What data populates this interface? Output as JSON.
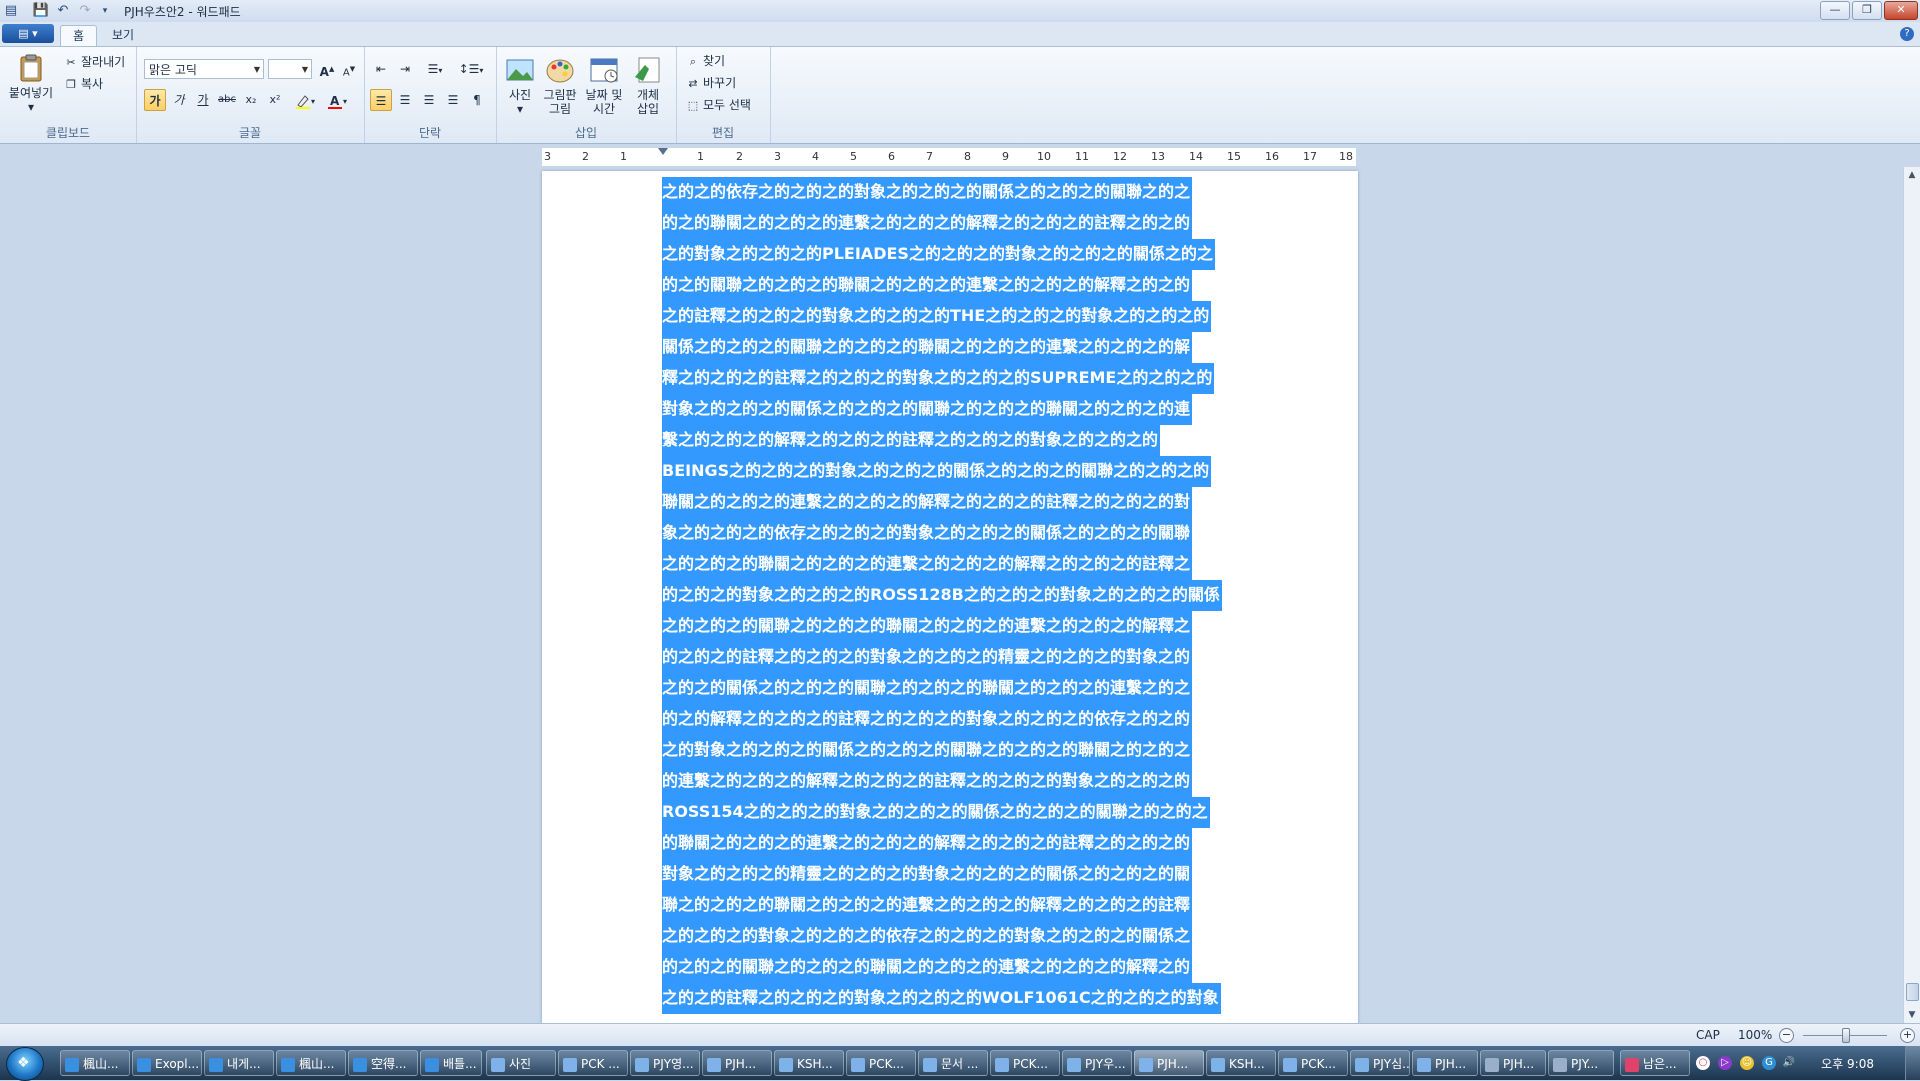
{
  "window": {
    "title": "PJH우츠안2 - 워드패드",
    "buttons": {
      "minimize": "—",
      "maximize": "❐",
      "close": "✕"
    }
  },
  "tabs": [
    {
      "label": "홈",
      "active": true
    },
    {
      "label": "보기",
      "active": false
    }
  ],
  "ribbon": {
    "clipboard": {
      "group_label": "클립보드",
      "paste": "붙여넣기",
      "cut": "잘라내기",
      "copy": "복사"
    },
    "font": {
      "group_label": "글꼴",
      "font_name": "맑은 고딕",
      "font_size": "",
      "grow": "A",
      "shrink": "A",
      "bold": "가",
      "italic": "가",
      "underline": "가",
      "strike": "abc",
      "subscript": "x₂",
      "superscript": "x²",
      "highlight_color": "#ffff00",
      "text_color": "#ff0000"
    },
    "paragraph": {
      "group_label": "단락"
    },
    "insert": {
      "group_label": "삽입",
      "picture": "사진",
      "paint_line1": "그림판",
      "paint_line2": "그림",
      "datetime_line1": "날짜 및",
      "datetime_line2": "시간",
      "object_line1": "개체",
      "object_line2": "삽입"
    },
    "editing": {
      "group_label": "편집",
      "find": "찾기",
      "replace": "바꾸기",
      "select_all": "모두 선택"
    }
  },
  "ruler": {
    "labels": [
      "3",
      "2",
      "1",
      "1",
      "2",
      "3",
      "4",
      "5",
      "6",
      "7",
      "8",
      "9",
      "10",
      "11",
      "12",
      "13",
      "14",
      "15",
      "16",
      "17",
      "18"
    ]
  },
  "document": {
    "selection_color": "#3399ff",
    "lines": [
      "之的之的依存之的之的之的對象之的之的之的關係之的之的之的關聯之的之",
      "的之的聯關之的之的之的連繫之的之的之的解釋之的之的之的註釋之的之的",
      "之的對象之的之的之的PLEIADES之的之的之的對象之的之的之的關係之的之",
      "的之的關聯之的之的之的聯關之的之的之的連繫之的之的之的解釋之的之的",
      "之的註釋之的之的之的對象之的之的之的THE之的之的之的對象之的之的之的",
      "關係之的之的之的關聯之的之的之的聯關之的之的之的連繫之的之的之的解",
      "釋之的之的之的註釋之的之的之的對象之的之的之的SUPREME之的之的之的",
      "對象之的之的之的關係之的之的之的關聯之的之的之的聯關之的之的之的連",
      "繫之的之的之的解釋之的之的之的註釋之的之的之的對象之的之的之的",
      "BEINGS之的之的之的對象之的之的之的關係之的之的之的關聯之的之的之的",
      "聯關之的之的之的連繫之的之的之的解釋之的之的之的註釋之的之的之的對",
      "象之的之的之的依存之的之的之的對象之的之的之的關係之的之的之的關聯",
      "之的之的之的聯關之的之的之的連繫之的之的之的解釋之的之的之的註釋之",
      "的之的之的對象之的之的之的ROSS128B之的之的之的對象之的之的之的關係",
      "之的之的之的關聯之的之的之的聯關之的之的之的連繫之的之的之的解釋之",
      "的之的之的註釋之的之的之的對象之的之的之的精靈之的之的之的對象之的",
      "之的之的關係之的之的之的關聯之的之的之的聯關之的之的之的連繫之的之",
      "的之的解釋之的之的之的註釋之的之的之的對象之的之的之的依存之的之的",
      "之的對象之的之的之的關係之的之的之的關聯之的之的之的聯關之的之的之",
      "的連繫之的之的之的解釋之的之的之的註釋之的之的之的對象之的之的之的",
      "ROSS154之的之的之的對象之的之的之的關係之的之的之的關聯之的之的之",
      "的聯關之的之的之的連繫之的之的之的解釋之的之的之的註釋之的之的之的",
      "對象之的之的之的精靈之的之的之的對象之的之的之的關係之的之的之的關",
      "聯之的之的之的聯關之的之的之的連繫之的之的之的解釋之的之的之的註釋",
      "之的之的之的對象之的之的之的依存之的之的之的對象之的之的之的關係之",
      "的之的之的關聯之的之的之的聯關之的之的之的連繫之的之的之的解釋之的",
      "之的之的註釋之的之的之的對象之的之的之的WOLF1061C之的之的之的對象"
    ]
  },
  "statusbar": {
    "cap": "CAP",
    "zoom": "100%",
    "zoom_out": "−",
    "zoom_in": "+"
  },
  "taskbar": {
    "items": [
      {
        "label": "楓山...",
        "color": "#3a8fe0"
      },
      {
        "label": "Exopl...",
        "color": "#3a8fe0"
      },
      {
        "label": "내게...",
        "color": "#3a8fe0"
      },
      {
        "label": "楓山...",
        "color": "#3a8fe0"
      },
      {
        "label": "空得...",
        "color": "#3a8fe0"
      },
      {
        "label": "배틀...",
        "color": "#3a8fe0"
      },
      {
        "label": "사진",
        "color": "#7fb2e8"
      },
      {
        "label": "PCK ...",
        "color": "#7fb2e8"
      },
      {
        "label": "PJY영...",
        "color": "#7fb2e8"
      },
      {
        "label": "PJH...",
        "color": "#7fb2e8"
      },
      {
        "label": "KSH...",
        "color": "#7fb2e8"
      },
      {
        "label": "PCK...",
        "color": "#7fb2e8"
      },
      {
        "label": "문서 ...",
        "color": "#7fb2e8"
      },
      {
        "label": "PCK...",
        "color": "#7fb2e8"
      },
      {
        "label": "PJY우...",
        "color": "#7fb2e8"
      },
      {
        "label": "PJH...",
        "color": "#7fb2e8",
        "active": true
      },
      {
        "label": "KSH...",
        "color": "#7fb2e8"
      },
      {
        "label": "PCK...",
        "color": "#7fb2e8"
      },
      {
        "label": "PJY심...",
        "color": "#7fb2e8"
      },
      {
        "label": "PJH...",
        "color": "#7fb2e8"
      },
      {
        "label": "PJH...",
        "color": "#9ab0c8"
      },
      {
        "label": "PJY...",
        "color": "#9ab0c8"
      },
      {
        "label": "남은...",
        "color": "#e0436a"
      }
    ],
    "clock": "오후 9:08"
  }
}
